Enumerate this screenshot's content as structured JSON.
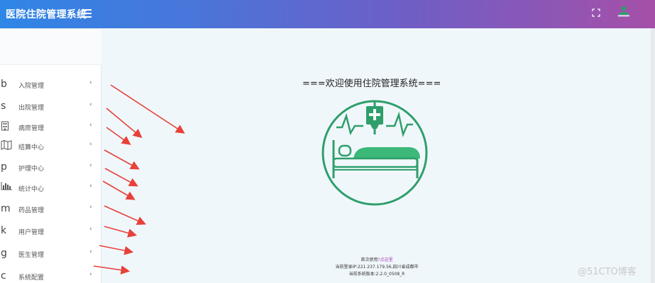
{
  "header": {
    "title": "医院住院管理系统",
    "menu_toggle_icon": "hamburger-icon",
    "fullscreen_icon": "fullscreen-icon",
    "user_icon": "user-avatar-icon",
    "colors": {
      "gradient_start": "#2f86e6",
      "gradient_end": "#a550a8"
    }
  },
  "sidebar": {
    "items": [
      {
        "icon": "b",
        "label": "入院管理",
        "chevron": "‹"
      },
      {
        "icon": "s",
        "label": "出院管理",
        "chevron": "‹"
      },
      {
        "icon": "building-icon",
        "label": "病房管理",
        "chevron": "‹"
      },
      {
        "icon": "map-icon",
        "label": "结算中心",
        "chevron": "‹"
      },
      {
        "icon": "p",
        "label": "护理中心",
        "chevron": "‹"
      },
      {
        "icon": "bar-chart-icon",
        "label": "统计中心",
        "chevron": "‹"
      },
      {
        "icon": "m",
        "label": "药品管理",
        "chevron": "‹"
      },
      {
        "icon": "k",
        "label": "用户管理",
        "chevron": "‹"
      },
      {
        "icon": "g",
        "label": "医生管理",
        "chevron": "‹"
      },
      {
        "icon": "c",
        "label": "系统配置",
        "chevron": "‹"
      }
    ]
  },
  "main": {
    "welcome": "===欢迎使用住院管理系统===",
    "logo_icon": "hospital-bed-icon",
    "logo_color": "#2e9f6b",
    "footer": {
      "first_use_prefix": "首次使用",
      "first_use_link": "?点这里",
      "login_ip": "当前登录IP:221.237.179.56,四川省成都市",
      "version": "当前系统版本:2.2.0_0508_R"
    }
  },
  "annotations": {
    "arrow_color": "#e8413a",
    "arrow_count": 10
  },
  "watermark": "@51CTO博客"
}
